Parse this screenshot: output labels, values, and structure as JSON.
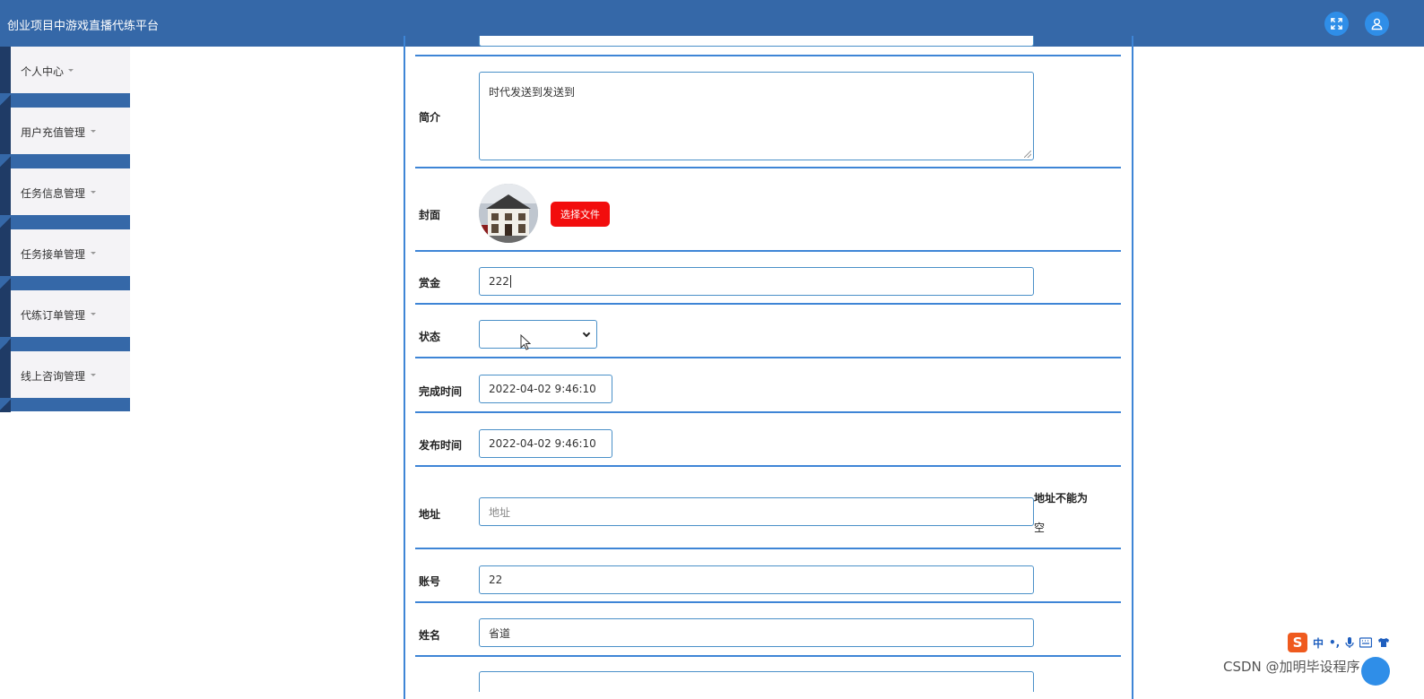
{
  "header": {
    "app_title": "创业项目中游戏直播代练平台",
    "fullscreen_icon": "fullscreen-icon",
    "user_icon": "user-icon"
  },
  "sidebar": {
    "items": [
      {
        "label": "个人中心"
      },
      {
        "label": "用户充值管理"
      },
      {
        "label": "任务信息管理"
      },
      {
        "label": "任务接单管理"
      },
      {
        "label": "代练订单管理"
      },
      {
        "label": "线上咨询管理"
      }
    ]
  },
  "form": {
    "intro": {
      "label": "简介",
      "value": "时代发送到发送到"
    },
    "cover": {
      "label": "封面",
      "button": "选择文件"
    },
    "reward": {
      "label": "赏金",
      "value": "222"
    },
    "status": {
      "label": "状态",
      "value": ""
    },
    "finish_time": {
      "label": "完成时间",
      "value": "2022-04-02 9:46:10"
    },
    "publish_time": {
      "label": "发布时间",
      "value": "2022-04-02 9:46:10"
    },
    "address": {
      "label": "地址",
      "placeholder": "地址",
      "error_line1": "地址不能为",
      "error_line2": "空"
    },
    "account": {
      "label": "账号",
      "value": "22"
    },
    "name": {
      "label": "姓名",
      "value": "省道"
    }
  },
  "overlay": {
    "ime_logo": "S",
    "ime_mode": "中",
    "ime_punct": "•,",
    "ime_icons": [
      "mic-icon",
      "keyboard-icon",
      "shirt-icon"
    ],
    "watermark": "CSDN @加明毕设程序"
  },
  "colors": {
    "header_bg": "#3568a8",
    "accent_line": "#3e85d6",
    "button_red": "#f20d0d",
    "sidebar_dark": "#1f3b66"
  }
}
